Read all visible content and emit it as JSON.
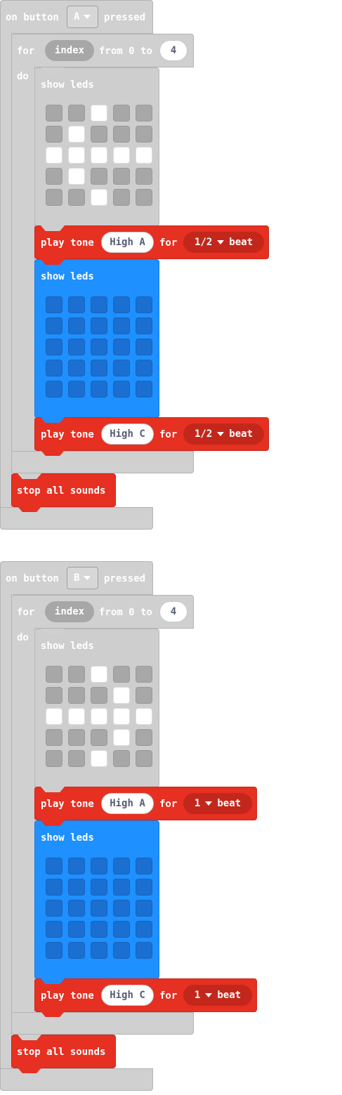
{
  "blocks": [
    {
      "event": {
        "prefix": "on button",
        "button": "A",
        "suffix": "pressed"
      },
      "loop": {
        "for": "for",
        "var": "index",
        "from": "from 0 to",
        "to": "4",
        "do": "do"
      },
      "show1": {
        "label": "show leds",
        "grid": [
          [
            0,
            0,
            1,
            0,
            0
          ],
          [
            0,
            1,
            0,
            0,
            0
          ],
          [
            1,
            1,
            1,
            1,
            1
          ],
          [
            0,
            1,
            0,
            0,
            0
          ],
          [
            0,
            0,
            1,
            0,
            0
          ]
        ]
      },
      "tone1": {
        "label": "play tone",
        "note": "High A",
        "for": "for",
        "beat": "1/2",
        "beat_label": "beat"
      },
      "show2": {
        "label": "show leds"
      },
      "tone2": {
        "label": "play tone",
        "note": "High C",
        "for": "for",
        "beat": "1/2",
        "beat_label": "beat"
      },
      "stop": "stop all sounds"
    },
    {
      "event": {
        "prefix": "on button",
        "button": "B",
        "suffix": "pressed"
      },
      "loop": {
        "for": "for",
        "var": "index",
        "from": "from 0 to",
        "to": "4",
        "do": "do"
      },
      "show1": {
        "label": "show leds",
        "grid": [
          [
            0,
            0,
            1,
            0,
            0
          ],
          [
            0,
            0,
            0,
            1,
            0
          ],
          [
            1,
            1,
            1,
            1,
            1
          ],
          [
            0,
            0,
            0,
            1,
            0
          ],
          [
            0,
            0,
            1,
            0,
            0
          ]
        ]
      },
      "tone1": {
        "label": "play tone",
        "note": "High A",
        "for": "for",
        "beat": "1",
        "beat_label": "beat"
      },
      "show2": {
        "label": "show leds"
      },
      "tone2": {
        "label": "play tone",
        "note": "High C",
        "for": "for",
        "beat": "1",
        "beat_label": "beat"
      },
      "stop": "stop all sounds"
    }
  ]
}
